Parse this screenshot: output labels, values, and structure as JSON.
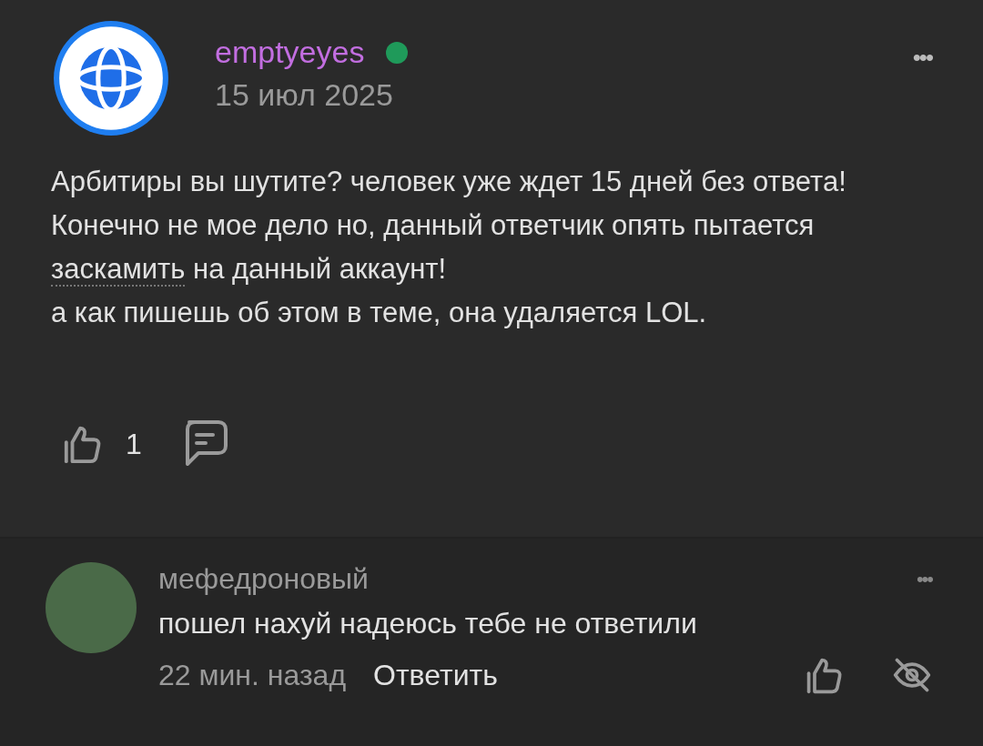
{
  "post": {
    "author": "emptyeyes",
    "online": true,
    "date": "15 июл 2025",
    "menu": "•••",
    "paragraphs": [
      {
        "text": "Арбитиры вы шутите? человек уже ждет 15 дней без ответа!"
      },
      {
        "before": "Конечно не мое дело но, данный ответчик опять пытается ",
        "link": "заскамить",
        "after": " на данный аккаунт!"
      },
      {
        "text": "а как пишешь об этом в теме, она удаляется LOL."
      }
    ],
    "likes": "1"
  },
  "reply": {
    "author": "мефедроновый",
    "text": "пошел нахуй надеюсь тебе не ответили",
    "time": "22 мин. назад",
    "reply_label": "Ответить",
    "menu": "•••"
  }
}
